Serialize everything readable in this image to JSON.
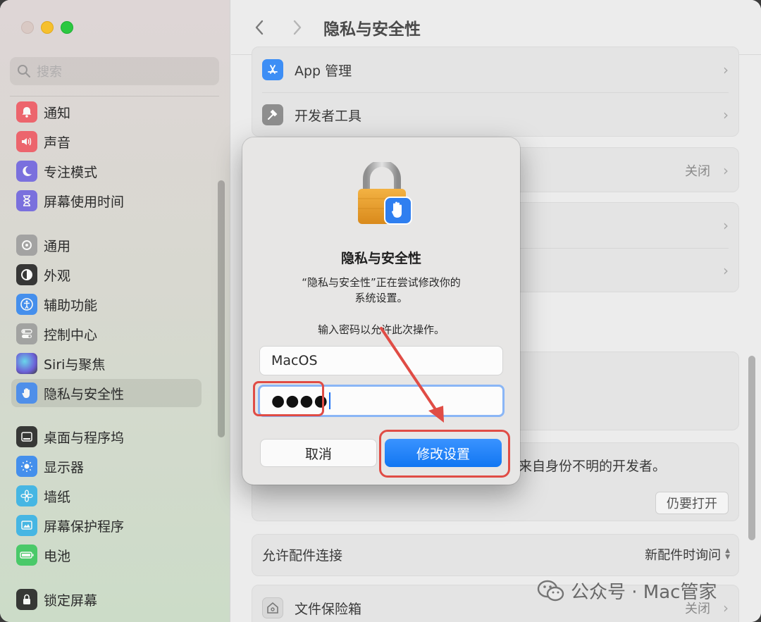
{
  "window": {
    "title": "隐私与安全性"
  },
  "sidebar": {
    "search_placeholder": "搜索",
    "items": [
      {
        "label": "通知",
        "icon": "bell-icon",
        "color": "#f0525c"
      },
      {
        "label": "声音",
        "icon": "speaker-icon",
        "color": "#f0525c"
      },
      {
        "label": "专注模式",
        "icon": "moon-icon",
        "color": "#6a5fe0"
      },
      {
        "label": "屏幕使用时间",
        "icon": "hourglass-icon",
        "color": "#6a5fe0"
      },
      {
        "label": "通用",
        "icon": "gear-icon",
        "color": "#9a9a9a"
      },
      {
        "label": "外观",
        "icon": "appearance-icon",
        "color": "#1c1c1c"
      },
      {
        "label": "辅助功能",
        "icon": "accessibility-icon",
        "color": "#2c83f2"
      },
      {
        "label": "控制中心",
        "icon": "toggles-icon",
        "color": "#9a9a9a"
      },
      {
        "label": "Siri与聚焦",
        "icon": "siri-icon",
        "color": "#5a4ad8"
      },
      {
        "label": "隐私与安全性",
        "icon": "hand-icon",
        "color": "#3b86f2"
      },
      {
        "label": "桌面与程序坞",
        "icon": "dock-icon",
        "color": "#1c1c1c"
      },
      {
        "label": "显示器",
        "icon": "sun-icon",
        "color": "#2c83f2"
      },
      {
        "label": "墙纸",
        "icon": "flower-icon",
        "color": "#2fb0e8"
      },
      {
        "label": "屏幕保护程序",
        "icon": "screensaver-icon",
        "color": "#2fb0e8"
      },
      {
        "label": "电池",
        "icon": "battery-icon",
        "color": "#34c759"
      },
      {
        "label": "锁定屏幕",
        "icon": "lock-icon",
        "color": "#1c1c1c"
      }
    ],
    "selected_index": 9
  },
  "main": {
    "title": "隐私与安全性",
    "rows": [
      {
        "label": "App 管理",
        "value": "",
        "icon": "app-store-icon"
      },
      {
        "label": "开发者工具",
        "value": "",
        "icon": "hammer-icon"
      },
      {
        "label": "",
        "value": "关闭"
      },
      {
        "label": "",
        "value": ""
      },
      {
        "label": "",
        "value": ""
      }
    ],
    "unidentified_text": "来自身份不明的开发者。",
    "still_open_label": "仍要打开",
    "accessory_label": "允许配件连接",
    "accessory_value": "新配件时询问",
    "filevault_label": "文件保险箱",
    "filevault_value": "关闭"
  },
  "dialog": {
    "title": "隐私与安全性",
    "message_line1": "“隐私与安全性”正在尝试修改你的",
    "message_line2": "系统设置。",
    "prompt": "输入密码以允许此次操作。",
    "username": "MacOS",
    "password_mask": "●●●●",
    "cancel_label": "取消",
    "ok_label": "修改设置"
  },
  "colors": {
    "accent": "#1176f2",
    "annotation": "#e04c45"
  },
  "watermark": {
    "text": "公众号 · Mac管家"
  }
}
